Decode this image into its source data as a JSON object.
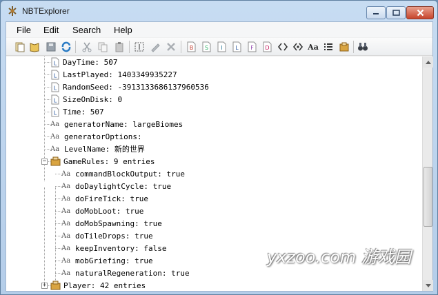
{
  "window": {
    "title": "NBTExplorer"
  },
  "menu": {
    "items": [
      "File",
      "Edit",
      "Search",
      "Help"
    ]
  },
  "toolbar": {
    "icons": [
      "open-folder-icon",
      "open-icon",
      "save-icon",
      "refresh-icon",
      "cut-icon",
      "copy-icon",
      "paste-icon",
      "rename-icon",
      "edit-icon",
      "delete-icon",
      "add-byte-icon",
      "add-short-icon",
      "add-int-icon",
      "add-long-icon",
      "add-float-icon",
      "add-double-icon",
      "add-byte-array-icon",
      "add-int-array-icon",
      "add-string-icon",
      "add-list-icon",
      "add-compound-icon",
      "find-icon"
    ],
    "tag_letters": [
      "B",
      "S",
      "I",
      "L",
      "F",
      "D"
    ],
    "string_label": "Aa"
  },
  "tree": {
    "rows": [
      {
        "icon": "long-tag-icon",
        "text": "DayTime: 507"
      },
      {
        "icon": "long-tag-icon",
        "text": "LastPlayed: 1403349935227"
      },
      {
        "icon": "long-tag-icon",
        "text": "RandomSeed: -3913133686137960536"
      },
      {
        "icon": "long-tag-icon",
        "text": "SizeOnDisk: 0"
      },
      {
        "icon": "long-tag-icon",
        "text": "Time: 507"
      },
      {
        "icon": "string-tag-icon",
        "text": "generatorName: largeBiomes"
      },
      {
        "icon": "string-tag-icon",
        "text": "generatorOptions:"
      },
      {
        "icon": "string-tag-icon",
        "text": "LevelName: 新的世界"
      },
      {
        "icon": "compound-tag-icon",
        "text": "GameRules: 9 entries",
        "expander": "−"
      },
      {
        "icon": "string-tag-icon",
        "text": "commandBlockOutput: true"
      },
      {
        "icon": "string-tag-icon",
        "text": "doDaylightCycle: true"
      },
      {
        "icon": "string-tag-icon",
        "text": "doFireTick: true"
      },
      {
        "icon": "string-tag-icon",
        "text": "doMobLoot: true"
      },
      {
        "icon": "string-tag-icon",
        "text": "doMobSpawning: true"
      },
      {
        "icon": "string-tag-icon",
        "text": "doTileDrops: true"
      },
      {
        "icon": "string-tag-icon",
        "text": "keepInventory: false"
      },
      {
        "icon": "string-tag-icon",
        "text": "mobGriefing: true"
      },
      {
        "icon": "string-tag-icon",
        "text": "naturalRegeneration: true"
      },
      {
        "icon": "compound-tag-icon",
        "text": "Player: 42 entries",
        "expander": "+"
      }
    ],
    "string_icon_label": "Aa",
    "long_icon_letter": "L"
  },
  "watermark": {
    "text": "yxzoo.com 游戏园"
  }
}
